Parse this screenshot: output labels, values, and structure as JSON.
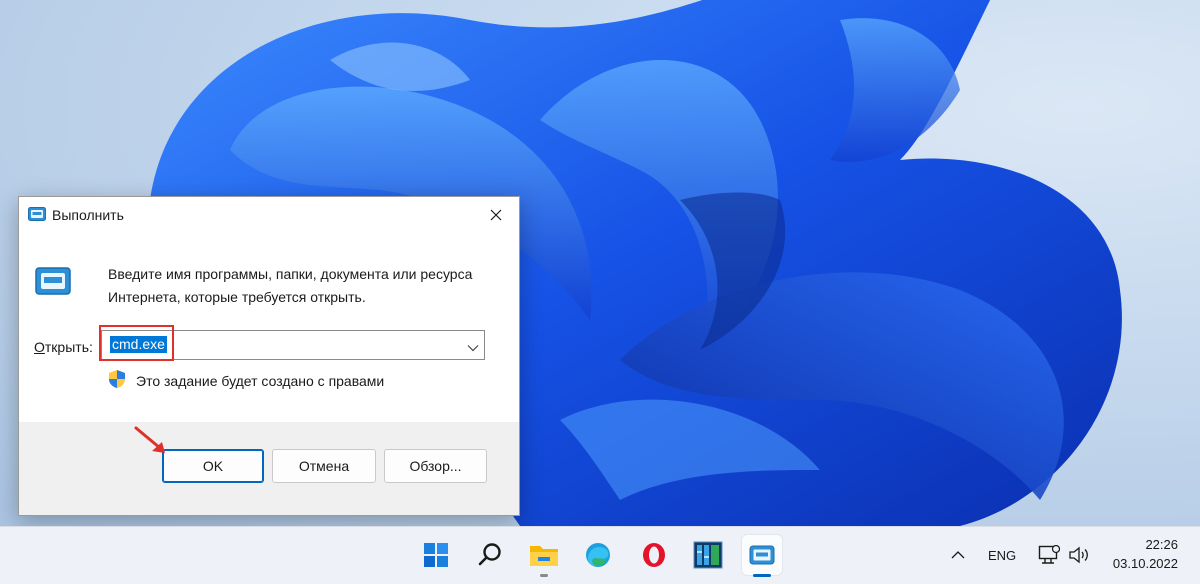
{
  "dialog": {
    "title": "Выполнить",
    "description": "Введите имя программы, папки, документа или ресурса Интернета, которые требуется открыть.",
    "open_label_access": "О",
    "open_label_rest": "ткрыть:",
    "combo_value": "cmd.exe",
    "admin_note": "Это задание будет создано с правами",
    "ok_label": "OK",
    "cancel_label": "Отмена",
    "browse_label": "Обзор..."
  },
  "taskbar": {
    "language": "ENG",
    "time": "22:26",
    "date": "03.10.2022",
    "apps": [
      "start-icon",
      "search-icon",
      "file-explorer-icon",
      "edge-icon",
      "opera-icon",
      "task-manager-icon",
      "run-icon"
    ]
  },
  "colors": {
    "accent": "#0078d7",
    "highlight_border": "#e0302a",
    "arrow": "#e0302a"
  }
}
